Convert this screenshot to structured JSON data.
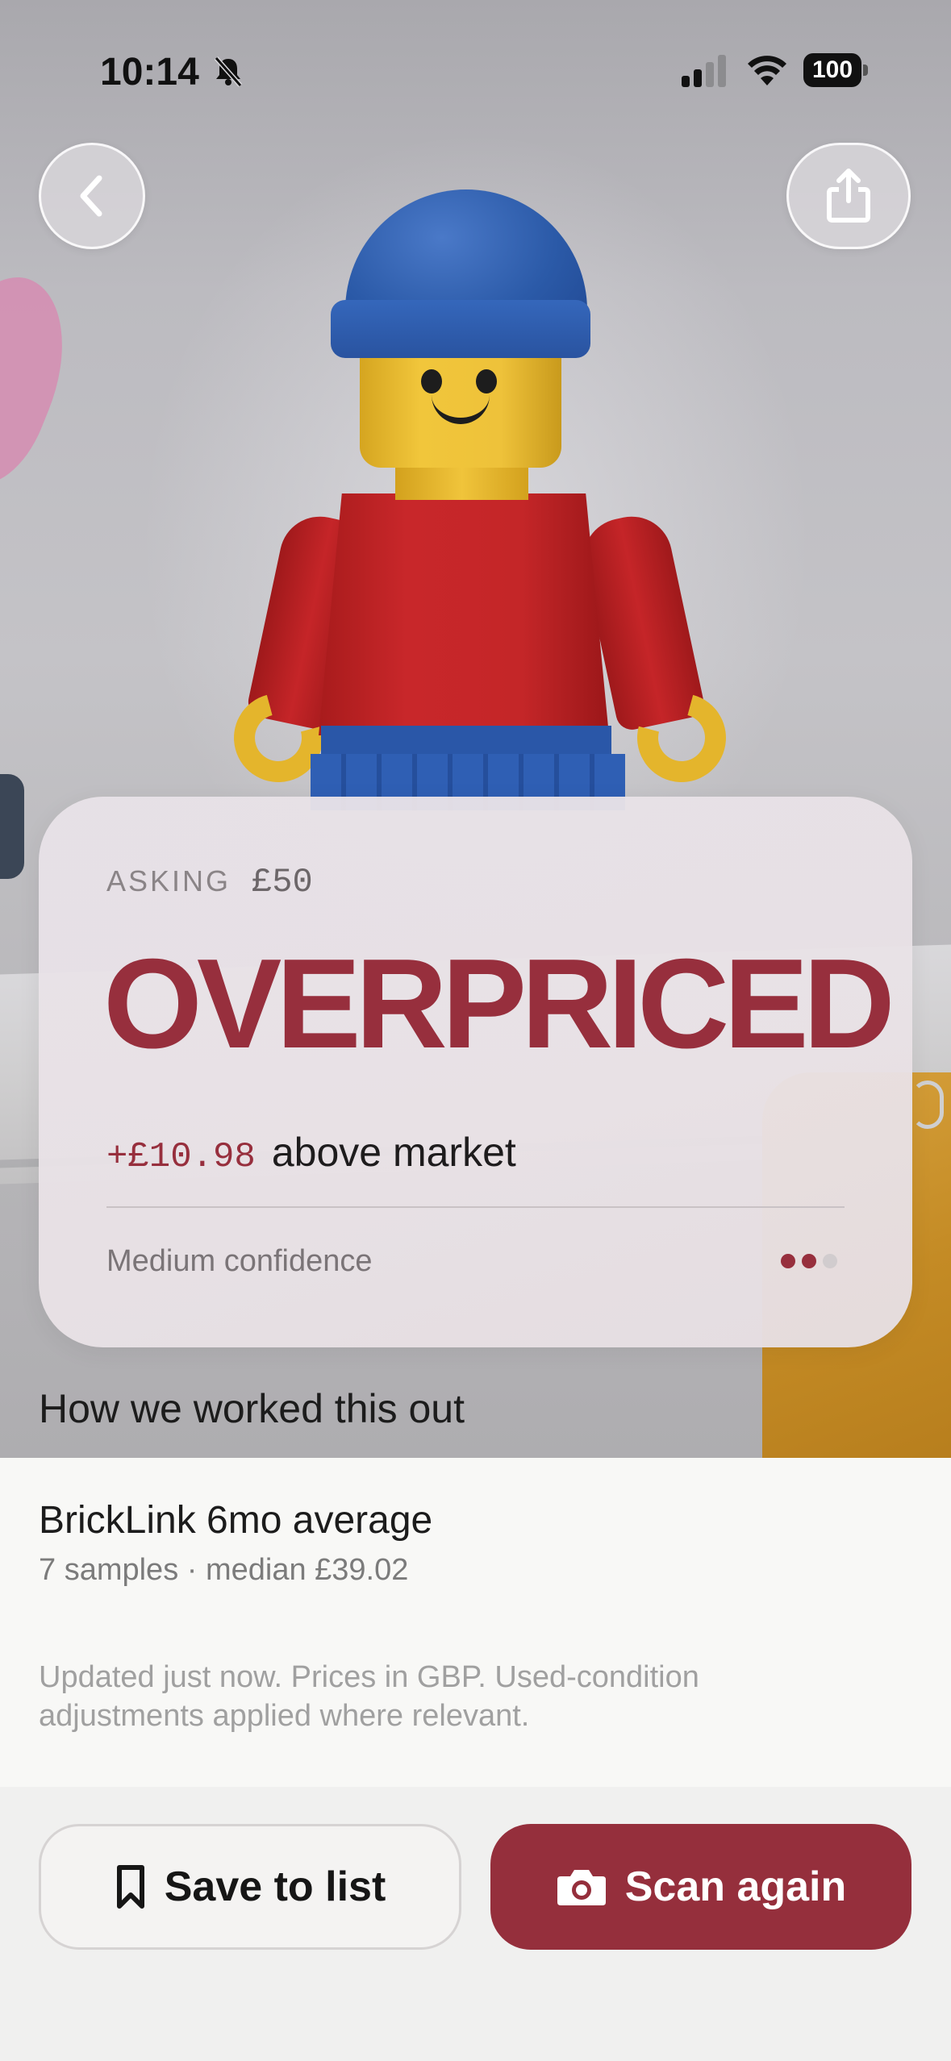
{
  "status_bar": {
    "time": "10:14",
    "battery": "100"
  },
  "nav": {
    "back_icon": "chevron-left-icon",
    "share_icon": "share-icon"
  },
  "verdict_card": {
    "asking_label": "ASKING",
    "asking_value": "£50",
    "verdict": "OVERPRICED",
    "difference_value": "+£10.98",
    "difference_label": "above market",
    "confidence_label": "Medium confidence",
    "confidence_level": 2,
    "confidence_max": 3,
    "accent_color": "#972f3d"
  },
  "explanation": {
    "heading": "How we worked this out",
    "source_title": "BrickLink 6mo average",
    "source_subtitle": "7 samples · median £39.02",
    "footnote": "Updated just now. Prices in GBP. Used-condition adjustments applied where relevant."
  },
  "actions": {
    "save_label": "Save to list",
    "save_icon": "bookmark-icon",
    "scan_label": "Scan again",
    "scan_icon": "camera-icon",
    "scan_color": "#952f3c"
  }
}
